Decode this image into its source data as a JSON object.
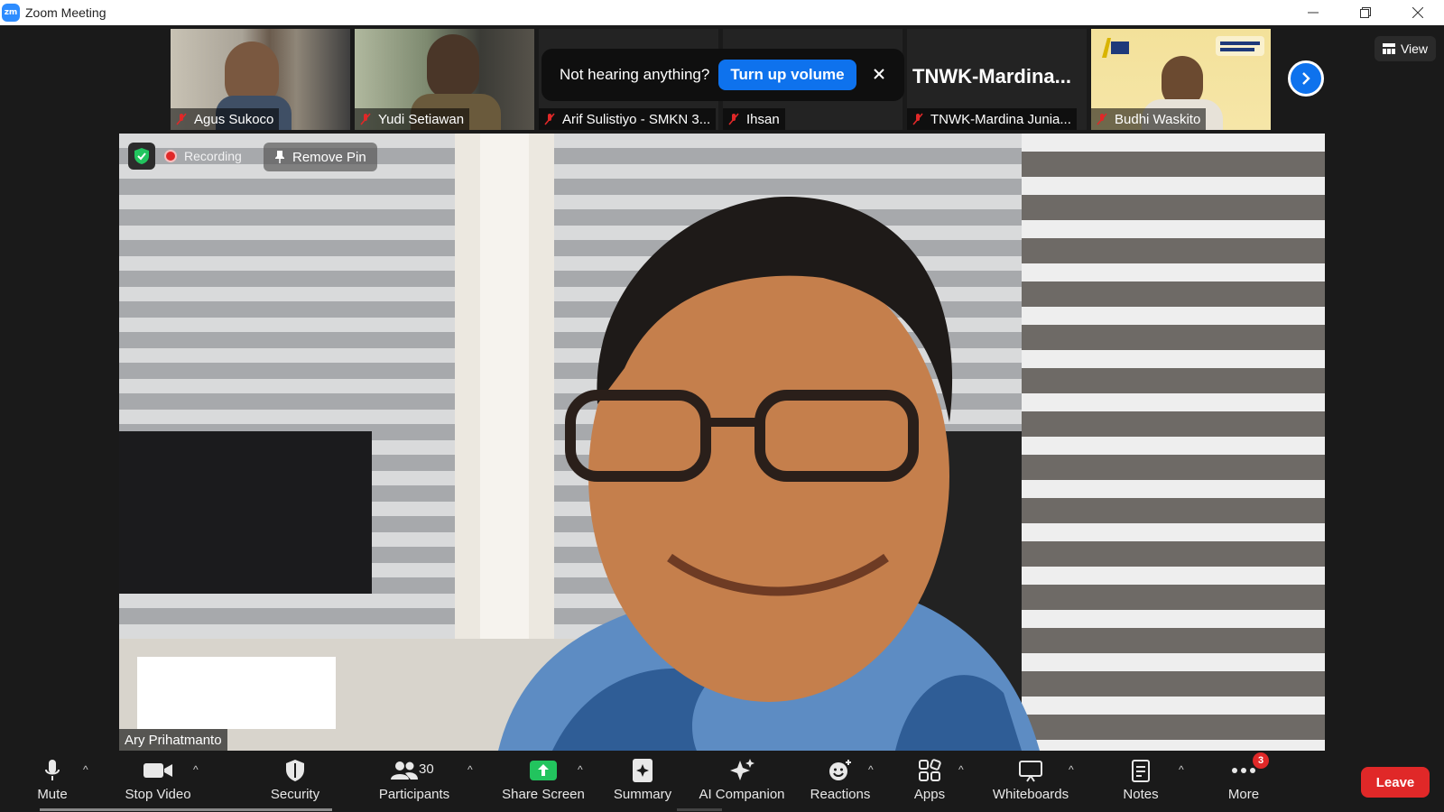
{
  "window": {
    "app_logo_text": "zm",
    "title": "Zoom Meeting"
  },
  "gallery": {
    "participants": [
      {
        "name": "Agus Sukoco",
        "muted": true
      },
      {
        "name": "Yudi Setiawan",
        "muted": true
      },
      {
        "name": "Arif Sulistiyo - SMKN 3...",
        "muted": true
      },
      {
        "name": "Ihsan",
        "muted": true
      },
      {
        "name": "TNWK-Mardina Junia...",
        "muted": true,
        "display_name": "TNWK-Mardina..."
      },
      {
        "name": "Budhi Waskito",
        "muted": true
      }
    ]
  },
  "toast": {
    "message": "Not hearing anything?",
    "button": "Turn up volume"
  },
  "view_button": "View",
  "main": {
    "speaker_name": "Ary Prihatmanto",
    "recording_label": "Recording",
    "remove_pin_label": "Remove Pin"
  },
  "toolbar": {
    "mute": "Mute",
    "stop_video": "Stop Video",
    "security": "Security",
    "participants": "Participants",
    "participants_count": "30",
    "share_screen": "Share Screen",
    "summary": "Summary",
    "ai_companion": "AI Companion",
    "reactions": "Reactions",
    "apps": "Apps",
    "whiteboards": "Whiteboards",
    "notes": "Notes",
    "more": "More",
    "more_badge": "3",
    "leave": "Leave"
  },
  "colors": {
    "accent_blue": "#0e72ed",
    "share_green": "#22c45e",
    "leave_red": "#e02828",
    "background": "#1a1a1a"
  }
}
